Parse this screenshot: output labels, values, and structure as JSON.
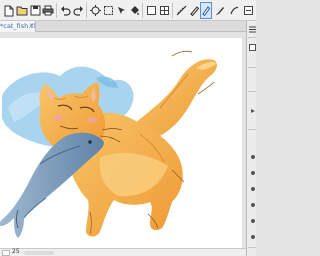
{
  "toolbar": {
    "tools": [
      {
        "id": "new",
        "icon": "new-document-icon"
      },
      {
        "id": "open",
        "icon": "open-folder-icon"
      },
      {
        "id": "save",
        "icon": "save-icon"
      },
      {
        "id": "print",
        "icon": "print-icon"
      },
      {
        "id": "undo",
        "icon": "undo-icon"
      },
      {
        "id": "redo",
        "icon": "redo-icon"
      },
      {
        "id": "select",
        "icon": "selection-icon"
      },
      {
        "id": "deselect",
        "icon": "clear-selection-icon"
      },
      {
        "id": "transform",
        "icon": "transform-icon"
      },
      {
        "id": "fill",
        "icon": "fill-bucket-icon"
      },
      {
        "id": "snap",
        "icon": "snap-icon"
      },
      {
        "id": "grid",
        "icon": "grid-icon"
      },
      {
        "id": "ruler",
        "icon": "ruler-icon"
      },
      {
        "id": "pen",
        "icon": "pen-icon"
      },
      {
        "id": "pencil",
        "icon": "pencil-icon",
        "active": true
      },
      {
        "id": "brush",
        "icon": "brush-icon"
      },
      {
        "id": "more",
        "icon": "more-icon"
      }
    ]
  },
  "document": {
    "tab_label": "*cat_fish.clip",
    "close_glyph": "×"
  },
  "status": {
    "zoom_text": "25"
  },
  "colors": {
    "accent": "#3d6fb8",
    "cat_fur": "#f4a83e",
    "cat_fur_light": "#f9cf7e",
    "fish_body": "#7a9ab8",
    "sky_splash": "#8fc6e8"
  }
}
